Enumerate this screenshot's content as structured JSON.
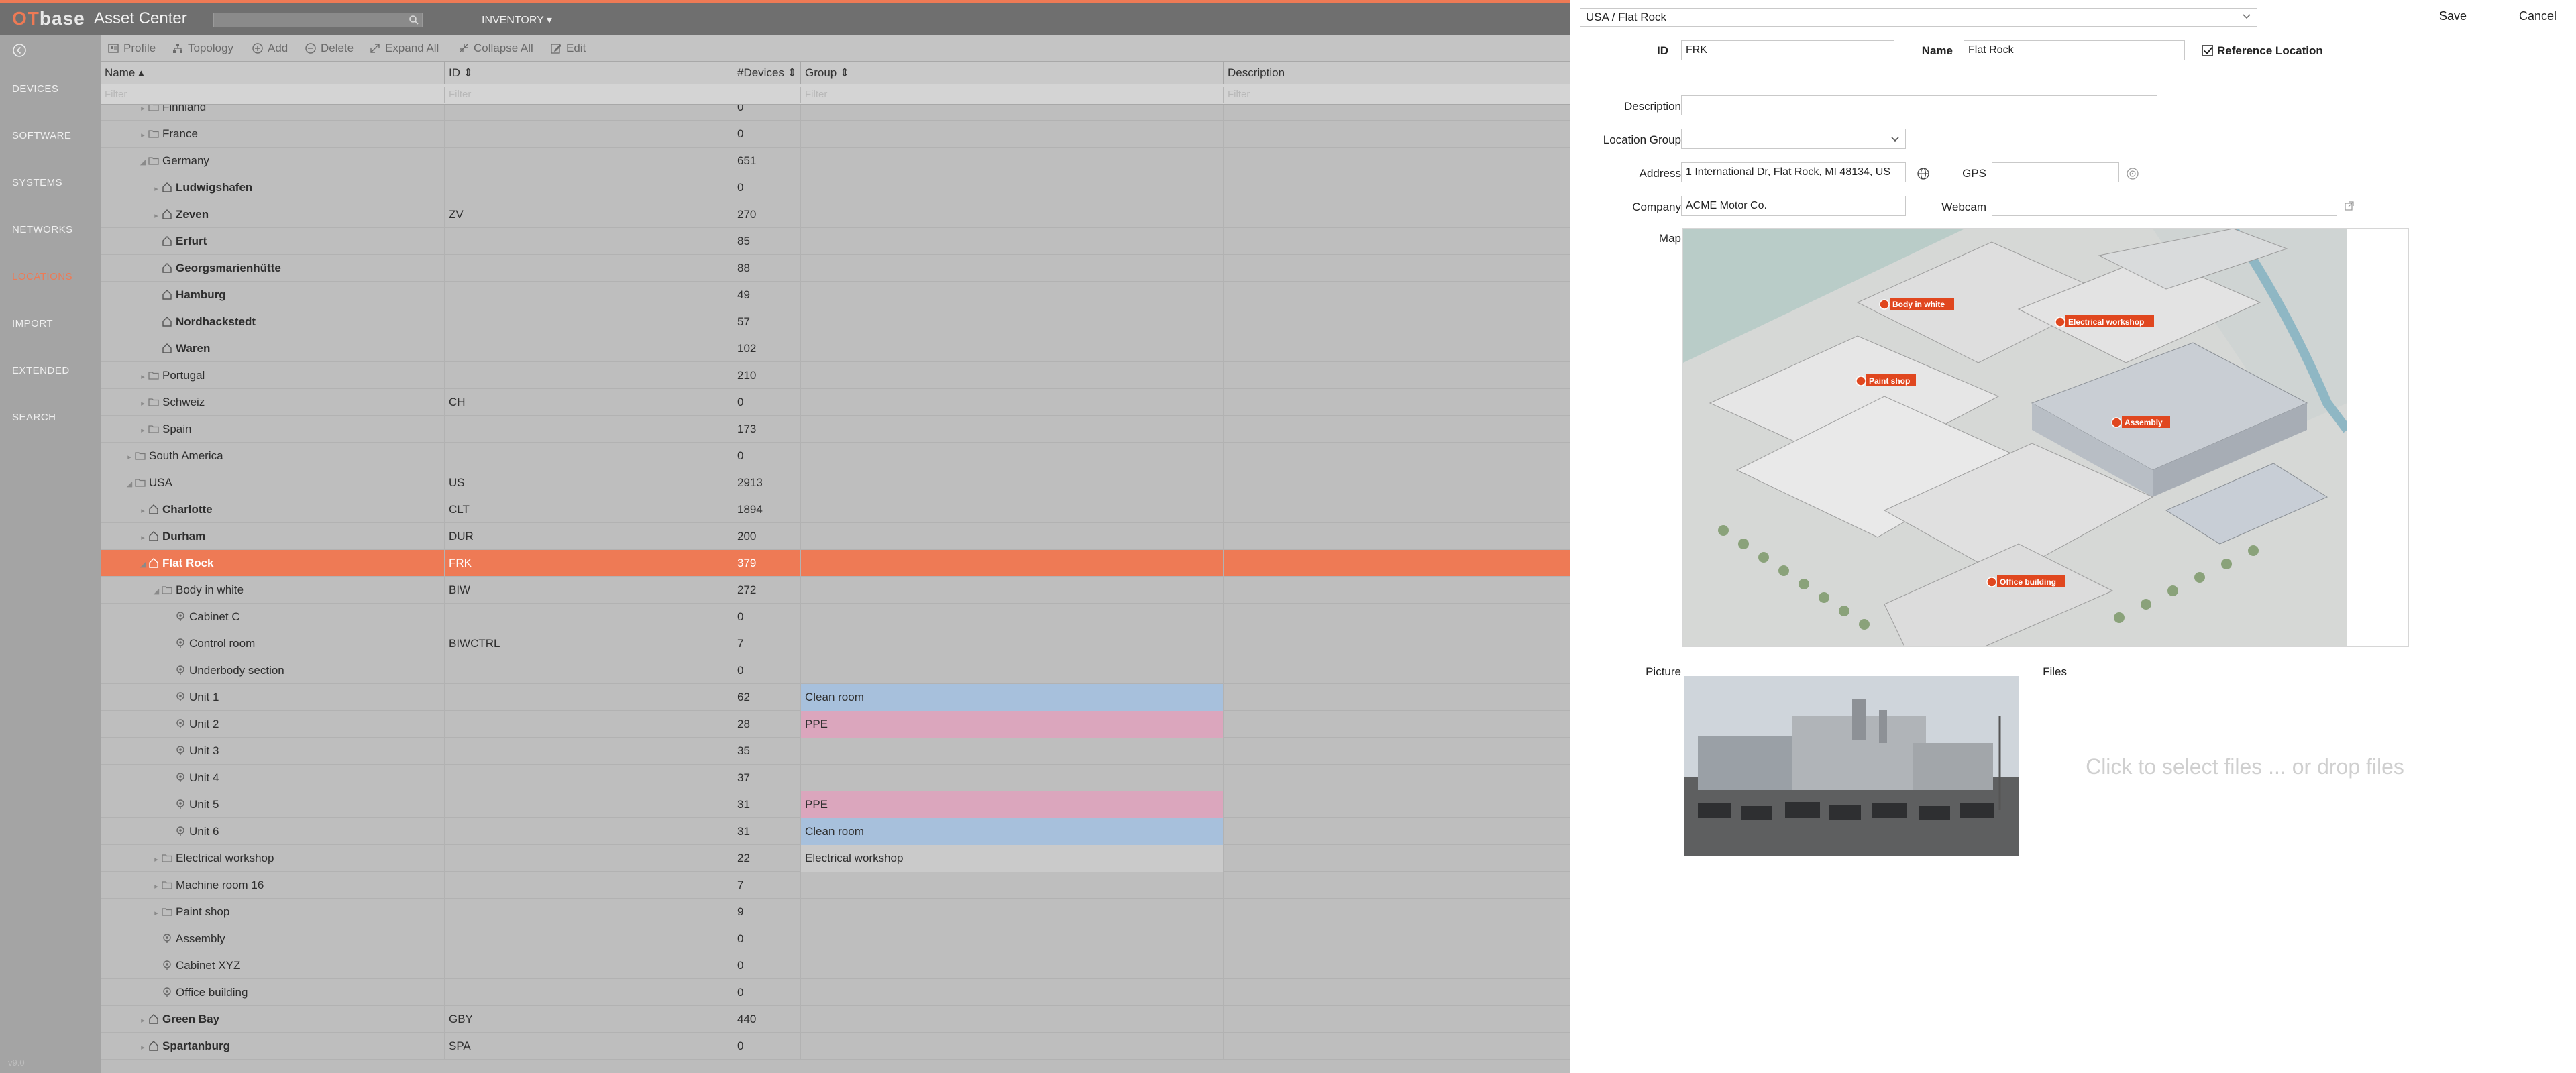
{
  "header": {
    "logo_ot": "OT",
    "logo_rest": "base",
    "app_title": "Asset Center",
    "search_placeholder": "",
    "inventory_menu": "INVENTORY ▾"
  },
  "sidebar": {
    "items": [
      "DEVICES",
      "SOFTWARE",
      "SYSTEMS",
      "NETWORKS",
      "LOCATIONS",
      "IMPORT",
      "EXTENDED",
      "SEARCH"
    ],
    "active": "LOCATIONS",
    "version": "v9.0"
  },
  "toolbar": {
    "profile": "Profile",
    "topology": "Topology",
    "add": "Add",
    "delete": "Delete",
    "expand_all": "Expand All",
    "collapse_all": "Collapse All",
    "edit": "Edit"
  },
  "columns": {
    "name": "Name ▴",
    "id": "ID ⇕",
    "devices": "#Devices ⇕",
    "group": "Group ⇕",
    "description": "Description"
  },
  "filter_placeholder": "Filter",
  "rows": [
    {
      "name": "Finnland",
      "id": "",
      "devices": "0",
      "group": "",
      "level": 2,
      "type": "folder",
      "bold": false,
      "twisty": "▸"
    },
    {
      "name": "France",
      "id": "",
      "devices": "0",
      "group": "",
      "level": 2,
      "type": "folder",
      "bold": false,
      "twisty": "▸"
    },
    {
      "name": "Germany",
      "id": "",
      "devices": "651",
      "group": "",
      "level": 2,
      "type": "folder",
      "bold": false,
      "twisty": "◢"
    },
    {
      "name": "Ludwigshafen",
      "id": "",
      "devices": "0",
      "group": "",
      "level": 3,
      "type": "site",
      "bold": true,
      "twisty": "▸"
    },
    {
      "name": "Zeven",
      "id": "ZV",
      "devices": "270",
      "group": "",
      "level": 3,
      "type": "site",
      "bold": true,
      "twisty": "▸"
    },
    {
      "name": "Erfurt",
      "id": "",
      "devices": "85",
      "group": "",
      "level": 3,
      "type": "site",
      "bold": true,
      "twisty": ""
    },
    {
      "name": "Georgsmarienhütte",
      "id": "",
      "devices": "88",
      "group": "",
      "level": 3,
      "type": "site",
      "bold": true,
      "twisty": ""
    },
    {
      "name": "Hamburg",
      "id": "",
      "devices": "49",
      "group": "",
      "level": 3,
      "type": "site",
      "bold": true,
      "twisty": ""
    },
    {
      "name": "Nordhackstedt",
      "id": "",
      "devices": "57",
      "group": "",
      "level": 3,
      "type": "site",
      "bold": true,
      "twisty": ""
    },
    {
      "name": "Waren",
      "id": "",
      "devices": "102",
      "group": "",
      "level": 3,
      "type": "site",
      "bold": true,
      "twisty": ""
    },
    {
      "name": "Portugal",
      "id": "",
      "devices": "210",
      "group": "",
      "level": 2,
      "type": "folder",
      "bold": false,
      "twisty": "▸"
    },
    {
      "name": "Schweiz",
      "id": "CH",
      "devices": "0",
      "group": "",
      "level": 2,
      "type": "folder",
      "bold": false,
      "twisty": "▸"
    },
    {
      "name": "Spain",
      "id": "",
      "devices": "173",
      "group": "",
      "level": 2,
      "type": "folder",
      "bold": false,
      "twisty": "▸"
    },
    {
      "name": "South America",
      "id": "",
      "devices": "0",
      "group": "",
      "level": 1,
      "type": "folder",
      "bold": false,
      "twisty": "▸"
    },
    {
      "name": "USA",
      "id": "US",
      "devices": "2913",
      "group": "",
      "level": 1,
      "type": "folder",
      "bold": false,
      "twisty": "◢"
    },
    {
      "name": "Charlotte",
      "id": "CLT",
      "devices": "1894",
      "group": "",
      "level": 2,
      "type": "site",
      "bold": true,
      "twisty": "▸"
    },
    {
      "name": "Durham",
      "id": "DUR",
      "devices": "200",
      "group": "",
      "level": 2,
      "type": "site",
      "bold": true,
      "twisty": "▸"
    },
    {
      "name": "Flat Rock",
      "id": "FRK",
      "devices": "379",
      "group": "",
      "level": 2,
      "type": "site",
      "bold": true,
      "twisty": "◢",
      "selected": true
    },
    {
      "name": "Body in white",
      "id": "BIW",
      "devices": "272",
      "group": "",
      "level": 3,
      "type": "folder",
      "bold": false,
      "twisty": "◢"
    },
    {
      "name": "Cabinet C",
      "id": "",
      "devices": "0",
      "group": "",
      "level": 4,
      "type": "pin",
      "bold": false,
      "twisty": ""
    },
    {
      "name": "Control room",
      "id": "BIWCTRL",
      "devices": "7",
      "group": "",
      "level": 4,
      "type": "pin",
      "bold": false,
      "twisty": ""
    },
    {
      "name": "Underbody section",
      "id": "",
      "devices": "0",
      "group": "",
      "level": 4,
      "type": "pin",
      "bold": false,
      "twisty": ""
    },
    {
      "name": "Unit 1",
      "id": "",
      "devices": "62",
      "group": "Clean room",
      "level": 4,
      "type": "pin",
      "bold": false,
      "twisty": "",
      "gclass": "clean"
    },
    {
      "name": "Unit 2",
      "id": "",
      "devices": "28",
      "group": "PPE",
      "level": 4,
      "type": "pin",
      "bold": false,
      "twisty": "",
      "gclass": "ppe"
    },
    {
      "name": "Unit 3",
      "id": "",
      "devices": "35",
      "group": "",
      "level": 4,
      "type": "pin",
      "bold": false,
      "twisty": ""
    },
    {
      "name": "Unit 4",
      "id": "",
      "devices": "37",
      "group": "",
      "level": 4,
      "type": "pin",
      "bold": false,
      "twisty": ""
    },
    {
      "name": "Unit 5",
      "id": "",
      "devices": "31",
      "group": "PPE",
      "level": 4,
      "type": "pin",
      "bold": false,
      "twisty": "",
      "gclass": "ppe"
    },
    {
      "name": "Unit 6",
      "id": "",
      "devices": "31",
      "group": "Clean room",
      "level": 4,
      "type": "pin",
      "bold": false,
      "twisty": "",
      "gclass": "clean"
    },
    {
      "name": "Electrical workshop",
      "id": "",
      "devices": "22",
      "group": "Electrical workshop",
      "level": 3,
      "type": "folder",
      "bold": false,
      "twisty": "▸",
      "gclass": "elec"
    },
    {
      "name": "Machine room 16",
      "id": "",
      "devices": "7",
      "group": "",
      "level": 3,
      "type": "folder",
      "bold": false,
      "twisty": "▸"
    },
    {
      "name": "Paint shop",
      "id": "",
      "devices": "9",
      "group": "",
      "level": 3,
      "type": "folder",
      "bold": false,
      "twisty": "▸"
    },
    {
      "name": "Assembly",
      "id": "",
      "devices": "0",
      "group": "",
      "level": 3,
      "type": "pin",
      "bold": false,
      "twisty": ""
    },
    {
      "name": "Cabinet XYZ",
      "id": "",
      "devices": "0",
      "group": "",
      "level": 3,
      "type": "pin",
      "bold": false,
      "twisty": ""
    },
    {
      "name": "Office building",
      "id": "",
      "devices": "0",
      "group": "",
      "level": 3,
      "type": "pin",
      "bold": false,
      "twisty": ""
    },
    {
      "name": "Green Bay",
      "id": "GBY",
      "devices": "440",
      "group": "",
      "level": 2,
      "type": "site",
      "bold": true,
      "twisty": "▸"
    },
    {
      "name": "Spartanburg",
      "id": "SPA",
      "devices": "0",
      "group": "",
      "level": 2,
      "type": "site",
      "bold": true,
      "twisty": "▸"
    }
  ],
  "panel": {
    "breadcrumb": "USA / Flat Rock",
    "save": "Save",
    "cancel": "Cancel",
    "id_label": "ID",
    "id_value": "FRK",
    "name_label": "Name",
    "name_value": "Flat Rock",
    "reference_label": "Reference Location",
    "description_label": "Description",
    "description_value": "",
    "location_group_label": "Location Group",
    "location_group_value": "",
    "address_label": "Address",
    "address_value": "1 International Dr, Flat Rock, MI 48134, US",
    "gps_label": "GPS",
    "gps_value": "",
    "company_label": "Company",
    "company_value": "ACME Motor Co.",
    "webcam_label": "Webcam",
    "webcam_value": "",
    "map_label": "Map",
    "map_markers": [
      "Body in white",
      "Electrical workshop",
      "Paint shop",
      "Assembly",
      "Office building"
    ],
    "picture_label": "Picture",
    "files_label": "Files",
    "files_placeholder": "Click to select files ... or drop files"
  },
  "colors": {
    "accent": "#ee7a55",
    "clean_room": "#a7c0dc",
    "ppe": "#dba6bd"
  }
}
